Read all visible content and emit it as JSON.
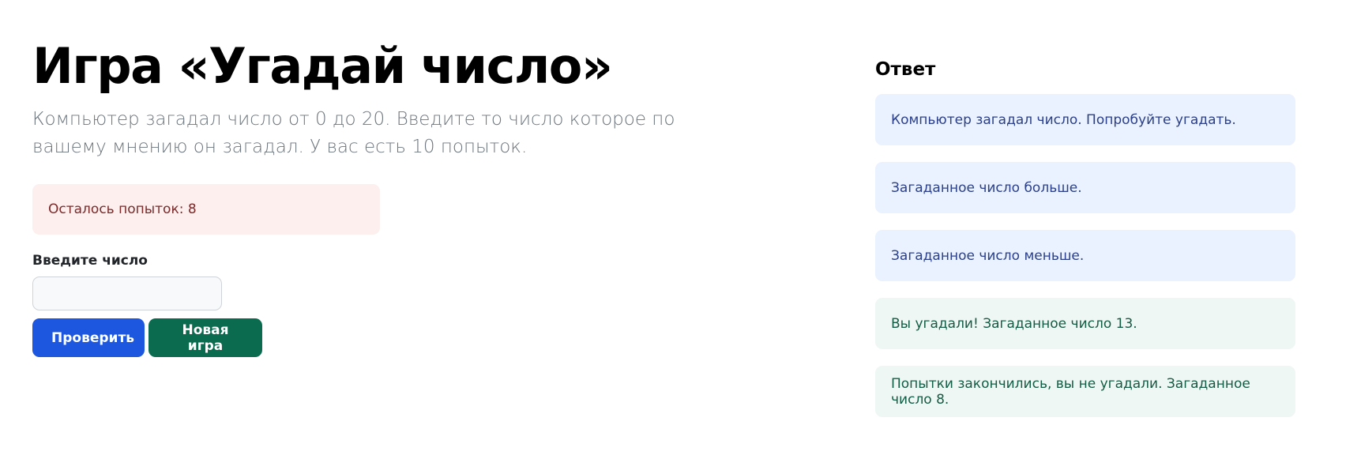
{
  "game": {
    "title": "Игра «Угадай число»",
    "description": "Компьютер загадал число от 0 до 20. Введите то число которое по вашему мнению он загадал. У вас есть 10 попыток.",
    "attempts_text": "Осталось попыток: 8",
    "input_label": "Введите число",
    "input_value": "",
    "check_button": "Проверить",
    "new_game_button": "Новая игра"
  },
  "answer": {
    "title": "Ответ",
    "messages": [
      {
        "text": "Компьютер загадал число. Попробуйте угадать.",
        "kind": "info"
      },
      {
        "text": "Загаданное число больше.",
        "kind": "info"
      },
      {
        "text": "Загаданное число меньше.",
        "kind": "info"
      },
      {
        "text": "Вы угадали! Загаданное число 13.",
        "kind": "success"
      },
      {
        "text": "Попытки закончились, вы не угадали. Загаданное число 8.",
        "kind": "success"
      }
    ]
  },
  "colors": {
    "primary": "#1d57e0",
    "success": "#0a6b4f",
    "danger_bg": "#fcefee",
    "info_bg": "#e9f2fe",
    "success_bg": "#eef7f3"
  }
}
